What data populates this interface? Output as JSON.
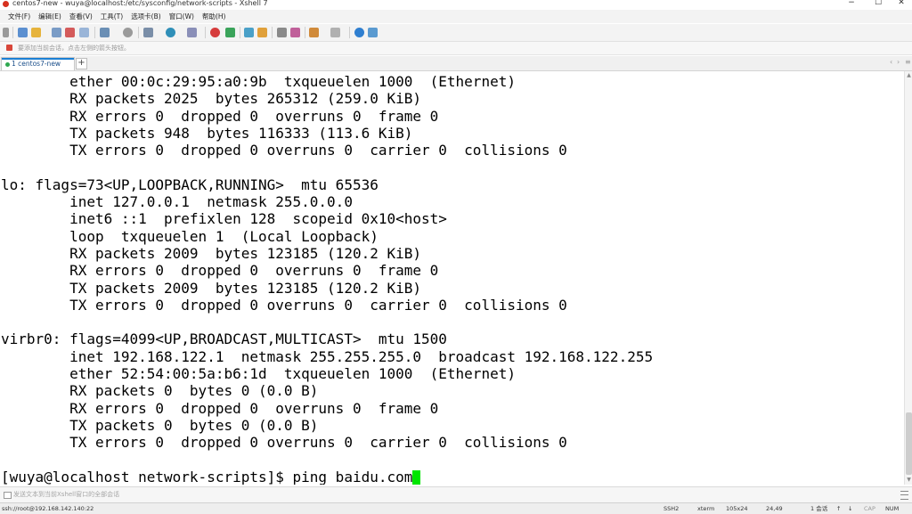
{
  "window": {
    "title": "centos7-new - wuya@localhost:/etc/sysconfig/network-scripts - Xshell 7",
    "controls": {
      "minimize": "−",
      "maximize": "☐",
      "close": "✕"
    }
  },
  "menu": [
    "文件(F)",
    "编辑(E)",
    "查看(V)",
    "工具(T)",
    "选项卡(B)",
    "窗口(W)",
    "帮助(H)"
  ],
  "toolbar": {
    "icons": [
      "new-session",
      "open-folder",
      "reconnect",
      "disconnect",
      "properties",
      "find",
      "transfer",
      "globe",
      "font",
      "xftp",
      "xagent",
      "fullscreen",
      "lock",
      "keyboard",
      "highlight",
      "script",
      "layout",
      "help",
      "chat"
    ]
  },
  "hint_bar": {
    "text": "要添加当前会话，点击左侧的箭头按钮。"
  },
  "tabs": {
    "active_label": "1 centos7-new",
    "add_label": "+",
    "nav_left": "‹",
    "nav_right": "›",
    "nav_menu": "≡"
  },
  "terminal": {
    "lines": [
      "        ether 00:0c:29:95:a0:9b  txqueuelen 1000  (Ethernet)",
      "        RX packets 2025  bytes 265312 (259.0 KiB)",
      "        RX errors 0  dropped 0  overruns 0  frame 0",
      "        TX packets 948  bytes 116333 (113.6 KiB)",
      "        TX errors 0  dropped 0 overruns 0  carrier 0  collisions 0",
      "",
      "lo: flags=73<UP,LOOPBACK,RUNNING>  mtu 65536",
      "        inet 127.0.0.1  netmask 255.0.0.0",
      "        inet6 ::1  prefixlen 128  scopeid 0x10<host>",
      "        loop  txqueuelen 1  (Local Loopback)",
      "        RX packets 2009  bytes 123185 (120.2 KiB)",
      "        RX errors 0  dropped 0  overruns 0  frame 0",
      "        TX packets 2009  bytes 123185 (120.2 KiB)",
      "        TX errors 0  dropped 0 overruns 0  carrier 0  collisions 0",
      "",
      "virbr0: flags=4099<UP,BROADCAST,MULTICAST>  mtu 1500",
      "        inet 192.168.122.1  netmask 255.255.255.0  broadcast 192.168.122.255",
      "        ether 52:54:00:5a:b6:1d  txqueuelen 1000  (Ethernet)",
      "        RX packets 0  bytes 0 (0.0 B)",
      "        RX errors 0  dropped 0  overruns 0  frame 0",
      "        TX packets 0  bytes 0 (0.0 B)",
      "        TX errors 0  dropped 0 overruns 0  carrier 0  collisions 0",
      ""
    ],
    "prompt": "[wuya@localhost network-scripts]$ ",
    "command": "ping baidu.com",
    "cursor_color": "#00e600"
  },
  "compose_bar": {
    "text": "发送文本到当前Xshell窗口的全部会话"
  },
  "status_bar": {
    "connection": "ssh://root@192.168.142.140:22",
    "protocol": "SSH2",
    "terminal_type": "xterm",
    "size": "105x24",
    "position": "24,49",
    "sessions": "1 会话",
    "cap": "CAP",
    "num": "NUM"
  },
  "colors": {
    "accent": "#1a7fd4",
    "terminal_bg": "#ffffff",
    "terminal_fg": "#000000",
    "cursor": "#00e600"
  }
}
